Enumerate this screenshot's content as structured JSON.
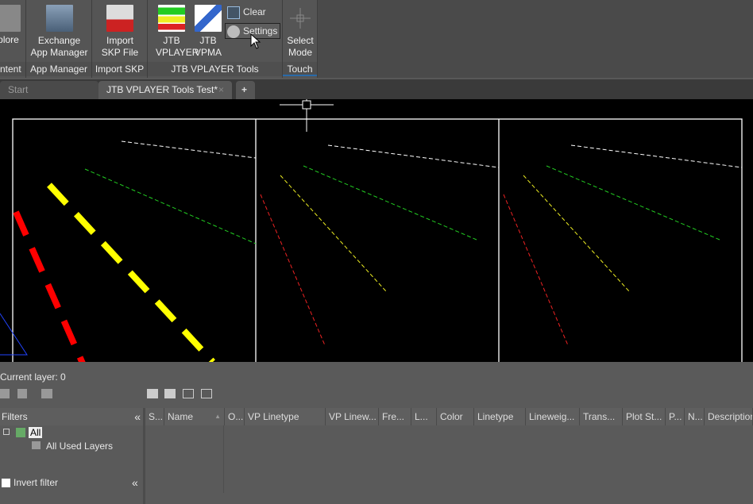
{
  "ribbon": {
    "panels": [
      {
        "title": "ntent",
        "buttons": [
          {
            "label": "plore"
          }
        ]
      },
      {
        "title": "App Manager",
        "buttons": [
          {
            "label": "Exchange App Manager"
          }
        ]
      },
      {
        "title": "Import SKP",
        "buttons": [
          {
            "label": "Import SKP File"
          }
        ]
      },
      {
        "title": "JTB VPLAYER Tools",
        "buttons": [
          {
            "label": "JTB VPLAYER"
          },
          {
            "label": "JTB VPMA"
          }
        ],
        "small_buttons": [
          {
            "label": "Clear"
          },
          {
            "label": "Settings"
          }
        ]
      },
      {
        "title": "Touch",
        "buttons": [
          {
            "label": "Select Mode"
          }
        ]
      }
    ]
  },
  "tabs": [
    {
      "label": "Start",
      "active": false
    },
    {
      "label": "JTB VPLAYER Tools Test*",
      "active": true
    }
  ],
  "new_tab_label": "+",
  "close_tab_label": "×",
  "layer_palette": {
    "current_layer": "Current layer: 0",
    "filters_label": "Filters",
    "collapse_label": "«",
    "tree": [
      {
        "label": "All"
      },
      {
        "label": "All Used Layers"
      }
    ],
    "invert_filter_label": "Invert filter",
    "columns": [
      "S...",
      "Name",
      "O...",
      "VP Linetype",
      "VP Linew...",
      "Fre...",
      "L...",
      "Color",
      "Linetype",
      "Lineweig...",
      "Trans...",
      "Plot St...",
      "P...",
      "N...",
      "Description"
    ]
  },
  "colors": {
    "accent_red": "#ff0000",
    "accent_yellow": "#ffff00",
    "accent_green": "#22cc22",
    "drawing_bg": "#000000"
  }
}
